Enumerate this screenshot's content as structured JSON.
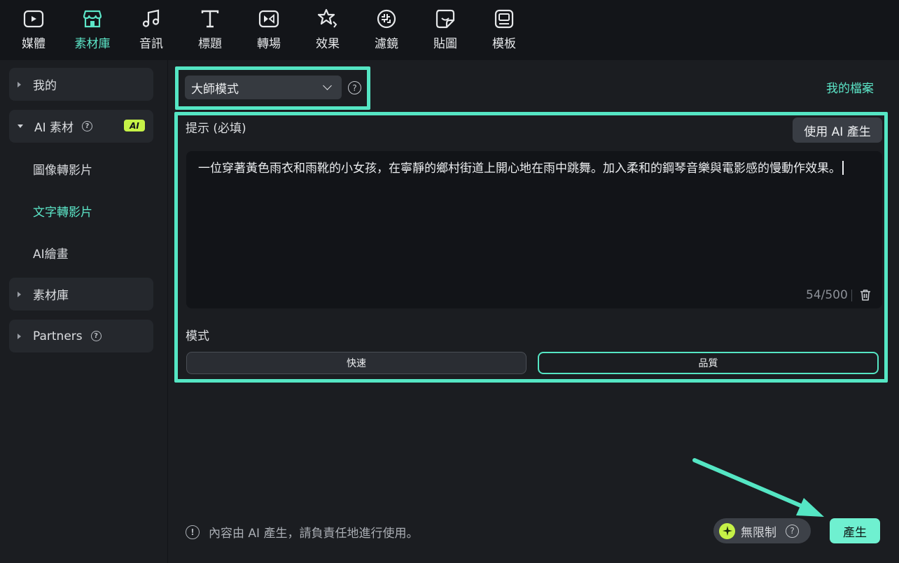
{
  "toolbar": {
    "items": [
      {
        "label": "媒體",
        "icon": "media-icon"
      },
      {
        "label": "素材庫",
        "icon": "store-icon"
      },
      {
        "label": "音訊",
        "icon": "music-icon"
      },
      {
        "label": "標題",
        "icon": "title-icon"
      },
      {
        "label": "轉場",
        "icon": "transition-icon"
      },
      {
        "label": "效果",
        "icon": "effects-icon"
      },
      {
        "label": "濾鏡",
        "icon": "filter-icon"
      },
      {
        "label": "貼圖",
        "icon": "sticker-icon"
      },
      {
        "label": "模板",
        "icon": "template-icon"
      }
    ],
    "active_index": 1
  },
  "sidebar": {
    "my": "我的",
    "ai_materials": "AI 素材",
    "ai_badge": "AI",
    "sub_items": [
      "圖像轉影片",
      "文字轉影片",
      "AI繪畫"
    ],
    "active_sub": "文字轉影片",
    "library": "素材庫",
    "partners": "Partners"
  },
  "main": {
    "mode_select": "大師模式",
    "my_files": "我的檔案",
    "prompt_label": "提示 (必填)",
    "use_ai_button": "使用 AI 產生",
    "prompt_text": "一位穿著黃色雨衣和雨靴的小女孩，在寧靜的鄉村街道上開心地在雨中跳舞。加入柔和的鋼琴音樂與電影感的慢動作效果。",
    "char_count": "54/500",
    "mode_label": "模式",
    "mode_options": [
      "快速",
      "品質"
    ],
    "selected_mode": "品質",
    "disclaimer": "內容由 AI 產生，請負責任地進行使用。",
    "unlimited": "無限制",
    "generate_button": "產生"
  },
  "colors": {
    "accent": "#5ce6c8",
    "highlight": "#55e6c4",
    "ai_badge": "#c6f247",
    "background": "#1b1d21",
    "toolbar_bg": "#131519"
  }
}
